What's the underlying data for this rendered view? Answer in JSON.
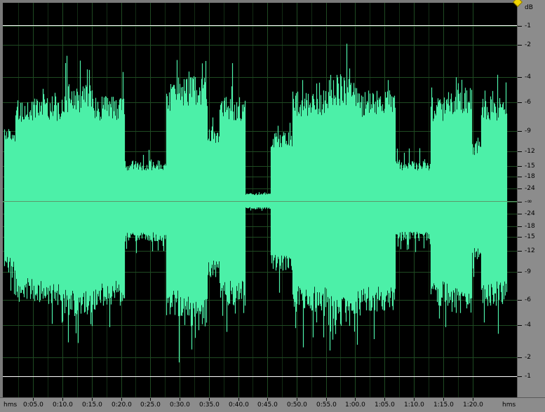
{
  "colors": {
    "waveform": "#4cf0a8",
    "background": "#000000",
    "grid": "#1f4a22",
    "center_line": "#5a9a6a",
    "marker_line": "#ffffff",
    "ruler": "#8c8c8c"
  },
  "db_ruler": {
    "unit": "dB",
    "labels": [
      "-1",
      "-2",
      "-4",
      "-6",
      "-9",
      "-12",
      "-15",
      "-18",
      "-24",
      "-∞",
      "-24",
      "-18",
      "-15",
      "-12",
      "-9",
      "-6",
      "-4",
      "-2",
      "-1"
    ]
  },
  "time_ruler": {
    "start_unit": "hms",
    "end_unit": "hms",
    "labels": [
      "0:05.0",
      "0:10.0",
      "0:15.0",
      "0:20.0",
      "0:25.0",
      "0:30.0",
      "0:35.0",
      "0:40.0",
      "0:45.0",
      "0:50.0",
      "0:55.0",
      "1:00.0",
      "1:05.0",
      "1:10.0",
      "1:15.0",
      "1:20.0"
    ]
  },
  "waveform": {
    "duration_seconds": 85.5,
    "segments": [
      {
        "from": 0.0,
        "to": 2.0,
        "level": 0.36
      },
      {
        "from": 2.0,
        "to": 5.0,
        "level": 0.5
      },
      {
        "from": 5.0,
        "to": 10.0,
        "level": 0.52
      },
      {
        "from": 10.0,
        "to": 15.0,
        "level": 0.58
      },
      {
        "from": 15.0,
        "to": 20.5,
        "level": 0.52
      },
      {
        "from": 20.5,
        "to": 27.5,
        "level": 0.2
      },
      {
        "from": 27.5,
        "to": 29.5,
        "level": 0.58
      },
      {
        "from": 29.5,
        "to": 34.5,
        "level": 0.62
      },
      {
        "from": 34.5,
        "to": 36.5,
        "level": 0.38
      },
      {
        "from": 36.5,
        "to": 41.0,
        "level": 0.52
      },
      {
        "from": 41.0,
        "to": 45.3,
        "level": 0.04
      },
      {
        "from": 45.3,
        "to": 49.0,
        "level": 0.35
      },
      {
        "from": 49.0,
        "to": 55.0,
        "level": 0.55
      },
      {
        "from": 55.0,
        "to": 60.0,
        "level": 0.62
      },
      {
        "from": 60.0,
        "to": 66.5,
        "level": 0.55
      },
      {
        "from": 66.5,
        "to": 72.5,
        "level": 0.2
      },
      {
        "from": 72.5,
        "to": 75.5,
        "level": 0.52
      },
      {
        "from": 75.5,
        "to": 79.5,
        "level": 0.56
      },
      {
        "from": 79.5,
        "to": 81.0,
        "level": 0.3
      },
      {
        "from": 81.0,
        "to": 85.5,
        "level": 0.52
      }
    ]
  }
}
